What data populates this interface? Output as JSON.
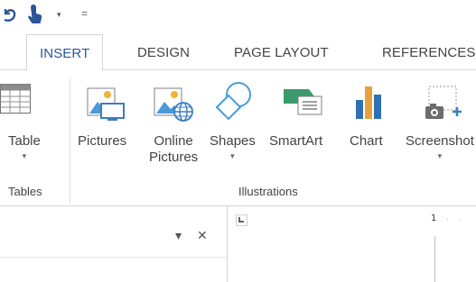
{
  "quick_access": {
    "dropdown_glyph": "▾",
    "customize_glyph": "="
  },
  "tabs": [
    {
      "label": "INSERT",
      "active": true
    },
    {
      "label": "DESIGN",
      "active": false
    },
    {
      "label": "PAGE LAYOUT",
      "active": false
    },
    {
      "label": "REFERENCES",
      "active": false
    }
  ],
  "ribbon": {
    "groups": [
      {
        "label": "Tables"
      },
      {
        "label": "Illustrations"
      }
    ],
    "buttons": {
      "table": {
        "label": "Table",
        "caret": "▾"
      },
      "pictures": {
        "label": "Pictures"
      },
      "online_pictures": {
        "line1": "Online",
        "line2": "Pictures"
      },
      "shapes": {
        "label": "Shapes",
        "caret": "▾"
      },
      "smartart": {
        "label": "SmartArt"
      },
      "chart": {
        "label": "Chart"
      },
      "screenshot": {
        "label": "Screenshot",
        "caret": "▾"
      }
    }
  },
  "nav_pane": {
    "dropdown_glyph": "▾",
    "close_glyph": "✕"
  },
  "ruler": {
    "tab_selector_glyph": "L",
    "number": "1",
    "ticks": "· ·"
  },
  "colors": {
    "accent": "#2b579a",
    "picture_blue": "#4a9bd8",
    "smartart_green": "#3c9b6e",
    "chart_blue": "#2f6fb4",
    "chart_orange": "#e8a13a"
  }
}
